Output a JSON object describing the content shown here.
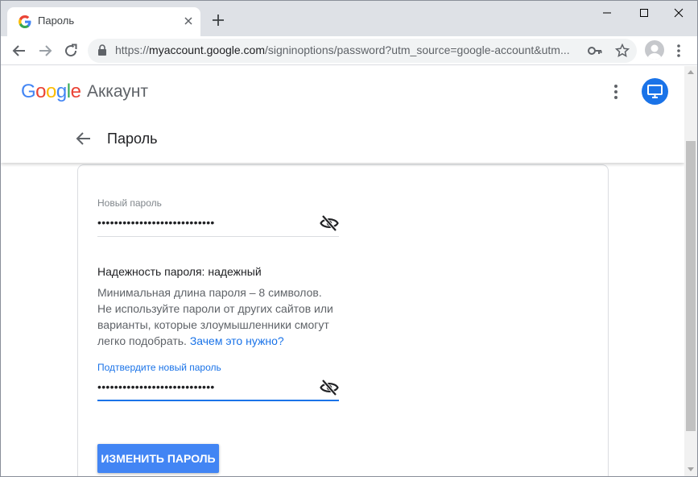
{
  "tab": {
    "title": "Пароль"
  },
  "address_bar": {
    "prefix": "https://",
    "host": "myaccount.google.com",
    "path": "/signinoptions/password?utm_source=google-account&utm..."
  },
  "header": {
    "logo": [
      "G",
      "o",
      "o",
      "g",
      "l",
      "e"
    ],
    "logo_colors": [
      "#4285f4",
      "#ea4335",
      "#fbbc05",
      "#4285f4",
      "#34a853",
      "#ea4335"
    ],
    "product": "Аккаунт",
    "page_title": "Пароль"
  },
  "form": {
    "new_password": {
      "label": "Новый пароль",
      "value": "••••••••••••••••••••••••••••"
    },
    "strength": {
      "label": "Надежность пароля:",
      "value": " надежный"
    },
    "hint": "Минимальная длина пароля – 8 символов. Не используйте пароли от других сайтов или варианты, которые злоумышленники смогут легко подобрать.",
    "hint_link": "Зачем это нужно?",
    "confirm_password": {
      "label": "Подтвердите новый пароль",
      "value": "••••••••••••••••••••••••••••"
    },
    "submit_label": "ИЗМЕНИТЬ ПАРОЛЬ"
  },
  "colors": {
    "accent": "#1a73e8",
    "button": "#4285f4"
  }
}
